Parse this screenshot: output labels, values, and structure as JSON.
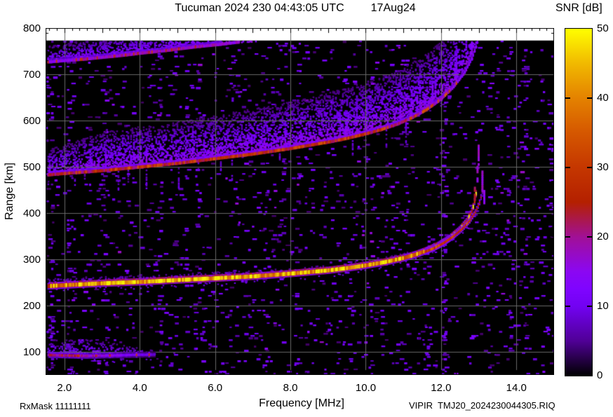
{
  "header": {
    "station_time": "Tucuman 2024 230 04:43:05 UTC",
    "date": "17Aug24"
  },
  "footer": {
    "rx_mask": "RxMask 11111111",
    "file_id": "VIPIR  TMJ20_2024230044305.RIQ"
  },
  "colorbar": {
    "label": "SNR [dB]",
    "min": 0,
    "max": 50,
    "tick_values": [
      0,
      10,
      20,
      30,
      40,
      50
    ],
    "tick_labels": [
      "0",
      "10",
      "20",
      "30",
      "40",
      "50"
    ],
    "gradient_stops": [
      {
        "db": 0,
        "color": "#000000"
      },
      {
        "db": 5,
        "color": "#500096"
      },
      {
        "db": 10,
        "color": "#7202f2"
      },
      {
        "db": 12.5,
        "color": "#7f04ff"
      },
      {
        "db": 15,
        "color": "#8b07f2"
      },
      {
        "db": 20,
        "color": "#a11096"
      },
      {
        "db": 25,
        "color": "#b42000"
      },
      {
        "db": 30,
        "color": "#c53700"
      },
      {
        "db": 35,
        "color": "#d55700"
      },
      {
        "db": 40,
        "color": "#e48200"
      },
      {
        "db": 45,
        "color": "#f1b900"
      },
      {
        "db": 50,
        "color": "#ffff00"
      }
    ]
  },
  "chart_data": {
    "type": "heatmap",
    "title": "Tucuman 2024 230 04:43:05 UTC   17Aug24",
    "xlabel": "Frequency [MHz]",
    "ylabel": "Range [km]",
    "value_label": "SNR [dB]",
    "xlim": [
      1.5,
      15.0
    ],
    "ylim": [
      50,
      800
    ],
    "value_range": [
      0,
      50
    ],
    "data_top_km": 773,
    "xtick_values": [
      2,
      4,
      6,
      8,
      10,
      12,
      14
    ],
    "xtick_labels": [
      "2.0",
      "4.0",
      "6.0",
      "8.0",
      "10.0",
      "12.0",
      "14.0"
    ],
    "ytick_values": [
      100,
      200,
      300,
      400,
      500,
      600,
      700,
      800
    ],
    "ytick_labels": [
      "100",
      "200",
      "300",
      "400",
      "500",
      "600",
      "700",
      "800"
    ],
    "x_minor_step_mhz": 0.2,
    "y_minor_step_km": 20,
    "grid": true,
    "grid_color": "#696969",
    "background_color": "#000000",
    "palette": "gnuplot pm3d: r=sqrt(t), g=t^3, b=sin(360*t)",
    "noise": {
      "seed": 20240230,
      "base_density": 0.05,
      "speckle_db_range": [
        3,
        16
      ]
    },
    "rfi_columns": [
      {
        "mhz": 1.62,
        "boost": 2.5
      },
      {
        "mhz": 2.08,
        "boost": 1.5
      },
      {
        "mhz": 3.05,
        "boost": 2.0
      },
      {
        "mhz": 4.5,
        "boost": 1.5
      },
      {
        "mhz": 5.5,
        "boost": 1.5
      },
      {
        "mhz": 7.3,
        "boost": 1.2
      },
      {
        "mhz": 12.02,
        "boost": 3.5
      },
      {
        "mhz": 13.45,
        "boost": 1.2
      },
      {
        "mhz": 14.2,
        "boost": 1.2
      }
    ],
    "traces": [
      {
        "name": "E-region echo",
        "hop": 1,
        "style": "line",
        "points": [
          [
            1.55,
            93
          ],
          [
            2.0,
            92
          ],
          [
            2.6,
            91
          ],
          [
            3.2,
            92
          ],
          [
            3.8,
            93
          ],
          [
            4.4,
            94
          ]
        ],
        "snr_db_profile": [
          [
            1.55,
            21
          ],
          [
            2.0,
            23
          ],
          [
            2.4,
            22
          ],
          [
            2.8,
            19
          ],
          [
            3.3,
            15
          ],
          [
            4.0,
            11
          ],
          [
            4.4,
            8
          ]
        ],
        "core_height_km": 6,
        "fuzz_up_km": [
          [
            1.55,
            34
          ],
          [
            2.6,
            40
          ],
          [
            3.4,
            26
          ],
          [
            4.4,
            10
          ]
        ],
        "fuzz_db": 13,
        "bead_p": 0.12,
        "bead_db": 27
      },
      {
        "name": "F-region 1st hop O-mode",
        "hop": 1,
        "style": "line",
        "points": [
          [
            1.55,
            242
          ],
          [
            2,
            244
          ],
          [
            2.5,
            246
          ],
          [
            3,
            248
          ],
          [
            4,
            251
          ],
          [
            5,
            255
          ],
          [
            6,
            259
          ],
          [
            7,
            263
          ],
          [
            8,
            269
          ],
          [
            9,
            276
          ],
          [
            9.5,
            281
          ],
          [
            10,
            287
          ],
          [
            10.5,
            294
          ],
          [
            11,
            303
          ],
          [
            11.3,
            310
          ],
          [
            11.6,
            319
          ],
          [
            11.9,
            330
          ],
          [
            12.2,
            345
          ],
          [
            12.45,
            362
          ],
          [
            12.65,
            381
          ],
          [
            12.78,
            400
          ],
          [
            12.86,
            420
          ],
          [
            12.91,
            442
          ],
          [
            12.93,
            458
          ]
        ],
        "snr_db_profile": [
          [
            1.55,
            30
          ],
          [
            2.2,
            40
          ],
          [
            3,
            43
          ],
          [
            5,
            44
          ],
          [
            8,
            45
          ],
          [
            9.5,
            44
          ],
          [
            10.5,
            42
          ],
          [
            11.2,
            38
          ],
          [
            11.8,
            34
          ],
          [
            12.4,
            31
          ],
          [
            12.93,
            26
          ]
        ],
        "core_height_km": 9,
        "fuzz_up_km": [
          [
            1.55,
            18
          ],
          [
            4,
            16
          ],
          [
            9,
            14
          ],
          [
            11,
            12
          ],
          [
            12.9,
            8
          ]
        ],
        "fuzz_db": 14,
        "bead_p": 0.3,
        "bead_db": 47,
        "critical_frequency_mhz": 12.9
      },
      {
        "name": "F-region 1st hop X-mode",
        "hop": 1,
        "style": "line",
        "points": [
          [
            11.55,
            316
          ],
          [
            11.8,
            324
          ],
          [
            12.05,
            335
          ],
          [
            12.3,
            349
          ],
          [
            12.55,
            366
          ],
          [
            12.75,
            384
          ],
          [
            12.9,
            403
          ],
          [
            13.0,
            422
          ],
          [
            13.07,
            443
          ],
          [
            13.11,
            462
          ]
        ],
        "snr_db_profile": [
          [
            11.55,
            30
          ],
          [
            12.3,
            30
          ],
          [
            12.8,
            27
          ],
          [
            13.11,
            22
          ]
        ],
        "core_height_km": 6,
        "fuzz_up_km": [
          [
            11.55,
            6
          ],
          [
            13.11,
            4
          ]
        ],
        "fuzz_db": 10,
        "bead_p": 0.15,
        "bead_db": 34,
        "critical_frequency_mhz": 13.1
      },
      {
        "name": "F-region 2nd hop",
        "hop": 2,
        "style": "edge",
        "points": [
          [
            1.55,
            483
          ],
          [
            2,
            486
          ],
          [
            2.5,
            489
          ],
          [
            3,
            492
          ],
          [
            3.5,
            496
          ],
          [
            4,
            500
          ],
          [
            4.5,
            504
          ],
          [
            5,
            508
          ],
          [
            5.5,
            513
          ],
          [
            6,
            518
          ],
          [
            6.5,
            523
          ],
          [
            7,
            528
          ],
          [
            7.5,
            534
          ],
          [
            8,
            540
          ],
          [
            8.5,
            547
          ],
          [
            9,
            554
          ],
          [
            9.5,
            562
          ],
          [
            10,
            572
          ],
          [
            10.4,
            581
          ],
          [
            10.8,
            592
          ],
          [
            11.2,
            606
          ],
          [
            11.6,
            624
          ],
          [
            12,
            648
          ],
          [
            12.3,
            672
          ],
          [
            12.6,
            703
          ],
          [
            12.8,
            734
          ],
          [
            12.9,
            757
          ],
          [
            12.96,
            773
          ]
        ],
        "snr_db_profile": [
          [
            1.55,
            22
          ],
          [
            2,
            24
          ],
          [
            4,
            26
          ],
          [
            6,
            27
          ],
          [
            8,
            28
          ],
          [
            9.5,
            26
          ],
          [
            10.5,
            24
          ],
          [
            11.5,
            20
          ],
          [
            12.2,
            17
          ],
          [
            12.96,
            13
          ]
        ],
        "fuzz_up_km": [
          [
            1.55,
            55
          ],
          [
            3,
            85
          ],
          [
            6,
            95
          ],
          [
            9,
            108
          ],
          [
            11,
            120
          ],
          [
            12.96,
            130
          ]
        ],
        "fuzz_db": 16,
        "bead_p": 0.28,
        "bead_db": 31,
        "down_streaks": true
      },
      {
        "name": "F-region 3rd hop",
        "hop": 3,
        "style": "edge",
        "points": [
          [
            1.55,
            727
          ],
          [
            2,
            730
          ],
          [
            2.5,
            733
          ],
          [
            3,
            737
          ],
          [
            3.5,
            741
          ],
          [
            4,
            746
          ],
          [
            4.5,
            750
          ],
          [
            5,
            755
          ],
          [
            5.5,
            760
          ],
          [
            6,
            764
          ],
          [
            6.5,
            769
          ],
          [
            7.1,
            773
          ]
        ],
        "snr_db_profile": [
          [
            1.55,
            15
          ],
          [
            2.5,
            18
          ],
          [
            4,
            19
          ],
          [
            5.5,
            19
          ],
          [
            6.5,
            17
          ],
          [
            7.1,
            14
          ]
        ],
        "fuzz_up_km": [
          [
            1.55,
            35
          ],
          [
            3,
            45
          ],
          [
            5,
            45
          ],
          [
            7.1,
            35
          ]
        ],
        "fuzz_db": 14,
        "bead_p": 0.1,
        "bead_db": 26,
        "down_streaks": false
      }
    ],
    "cusp_echoes": [
      {
        "mhz": 12.87,
        "km_range": [
          432,
          466
        ],
        "snr_db": 20
      },
      {
        "mhz": 12.94,
        "km_range": [
          472,
          506
        ],
        "snr_db": 15
      },
      {
        "mhz": 12.97,
        "km_range": [
          508,
          548
        ],
        "snr_db": 15
      },
      {
        "mhz": 13.07,
        "km_range": [
          452,
          495
        ],
        "snr_db": 15
      },
      {
        "mhz": 13.12,
        "km_range": [
          425,
          450
        ],
        "snr_db": 13
      }
    ]
  }
}
